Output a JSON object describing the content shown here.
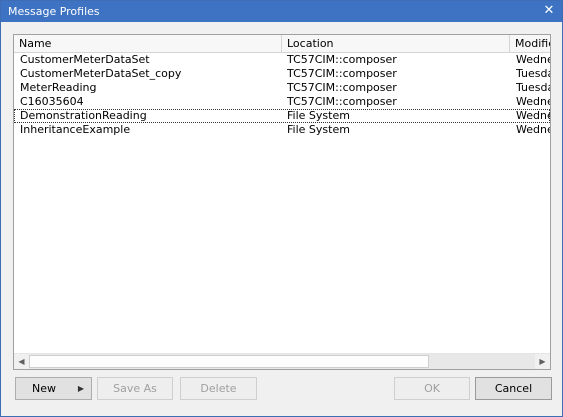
{
  "dialog": {
    "title": "Message Profiles",
    "close_glyph": "✕",
    "close_icon": "close-icon"
  },
  "columns": {
    "name": "Name",
    "location": "Location",
    "modified": "Modified"
  },
  "rows": [
    {
      "name": "CustomerMeterDataSet",
      "location": "TC57CIM::composer",
      "modified": "Wednesday"
    },
    {
      "name": "CustomerMeterDataSet_copy",
      "location": "TC57CIM::composer",
      "modified": "Tuesday"
    },
    {
      "name": "MeterReading",
      "location": "TC57CIM::composer",
      "modified": "Tuesday"
    },
    {
      "name": "C16035604",
      "location": "TC57CIM::composer",
      "modified": "Wednesday"
    },
    {
      "name": "DemonstrationReading",
      "location": "File System",
      "modified": "Wednesday"
    },
    {
      "name": "InheritanceExample",
      "location": "File System",
      "modified": "Wednesday"
    }
  ],
  "focused_row_index": 4,
  "scrollbar": {
    "left_glyph": "◀",
    "right_glyph": "▶"
  },
  "buttons": {
    "new": "New",
    "new_caret": "▶",
    "save_as": "Save As",
    "delete": "Delete",
    "ok": "OK",
    "cancel": "Cancel"
  }
}
